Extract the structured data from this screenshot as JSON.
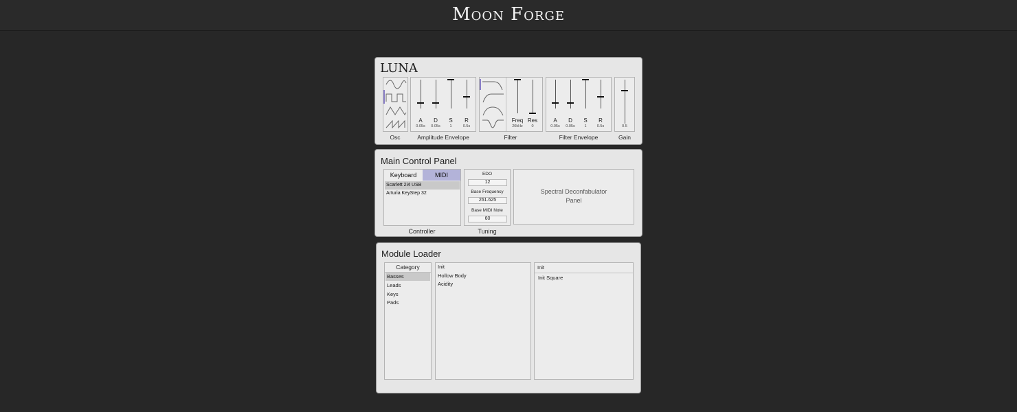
{
  "app": {
    "title": "Moon Forge"
  },
  "luna": {
    "title": "LUNA",
    "sections": {
      "osc": "Osc",
      "amp_env": "Amplitude Envelope",
      "filter": "Filter",
      "filter_env": "Filter Envelope",
      "gain": "Gain"
    },
    "osc_waves": [
      "sine-wave-icon",
      "square-wave-icon",
      "triangle-wave-icon",
      "sawtooth-wave-icon"
    ],
    "amp_env": [
      {
        "label": "A",
        "value": "0.05s",
        "level": 0.2
      },
      {
        "label": "D",
        "value": "0.05s",
        "level": 0.2
      },
      {
        "label": "S",
        "value": "1",
        "level": 1.0
      },
      {
        "label": "R",
        "value": "0.5s",
        "level": 0.4
      }
    ],
    "filter_types": [
      "lowpass-curve-icon",
      "highpass-curve-icon",
      "bandpass-curve-icon",
      "notch-curve-icon"
    ],
    "filter": [
      {
        "label": "Freq",
        "value": "20kHz",
        "level": 1.0
      },
      {
        "label": "Res",
        "value": "0",
        "level": 0.0
      }
    ],
    "filter_env": [
      {
        "label": "A",
        "value": "0.05s",
        "level": 0.2
      },
      {
        "label": "D",
        "value": "0.05s",
        "level": 0.2
      },
      {
        "label": "S",
        "value": "1",
        "level": 1.0
      },
      {
        "label": "R",
        "value": "0.5s",
        "level": 0.4
      }
    ],
    "gain": {
      "value": "0.5",
      "level": 0.75
    }
  },
  "main_control": {
    "title": "Main Control Panel",
    "controller": {
      "label": "Controller",
      "tabs": {
        "keyboard": "Keyboard",
        "midi": "MIDI"
      },
      "active_tab": "MIDI",
      "devices": [
        "Scarlett 2i4 USB",
        "Arturia KeyStep 32"
      ],
      "selected_device": "Scarlett 2i4 USB"
    },
    "tuning": {
      "label": "Tuning",
      "edo_label": "EDO",
      "edo_value": "12",
      "base_freq_label": "Base Frequency",
      "base_freq_value": "261.625",
      "base_midi_label": "Base MIDI Note",
      "base_midi_value": "60"
    },
    "spectral": {
      "line1": "Spectral Deconfabulator",
      "line2": "Panel"
    }
  },
  "module_loader": {
    "title": "Module Loader",
    "category_header": "Category",
    "categories": [
      "Basses",
      "Leads",
      "Keys",
      "Pads"
    ],
    "selected_category": "Basses",
    "presets_header": "Init",
    "presets": [
      "Hollow Body",
      "Acidity"
    ],
    "detail_header": "Init",
    "detail_items": [
      "Init Square"
    ]
  },
  "colors": {
    "background": "#272727",
    "panel": "#e6e6e6",
    "midi_tab": "#b3b3d9",
    "selection": "#c9c9c9"
  }
}
